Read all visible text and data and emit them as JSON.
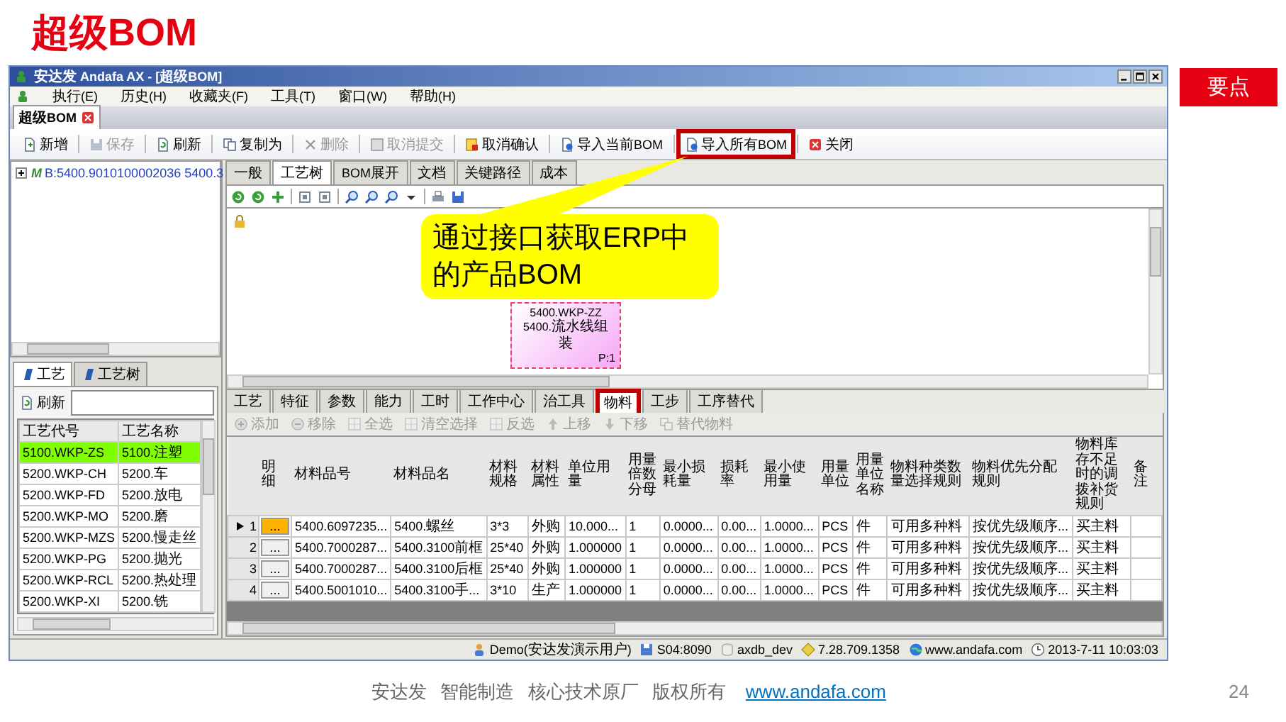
{
  "slide": {
    "title": "超级BOM",
    "aside_heading": "要点",
    "footer_text": "安达发 智能制造 核心技术原厂 版权所有",
    "footer_link": "www.andafa.com",
    "page_number": "24"
  },
  "window": {
    "title": "安达发 Andafa AX - [超级BOM]"
  },
  "menu": [
    "执行(E)",
    "历史(H)",
    "收藏夹(F)",
    "工具(T)",
    "窗口(W)",
    "帮助(H)"
  ],
  "document_tabs": [
    {
      "label": "超级BOM",
      "selected": true
    }
  ],
  "toolbar": [
    {
      "kind": "new",
      "label": "新增",
      "disabled": false,
      "highlighted": false
    },
    {
      "kind": "save",
      "label": "保存",
      "disabled": true,
      "highlighted": false
    },
    {
      "kind": "refresh",
      "label": "刷新",
      "disabled": false,
      "highlighted": false
    },
    {
      "kind": "copy",
      "label": "复制为",
      "disabled": false,
      "highlighted": false
    },
    {
      "kind": "delete",
      "label": "删除",
      "disabled": true,
      "highlighted": false
    },
    {
      "kind": "submit",
      "label": "取消提交",
      "disabled": true,
      "highlighted": false
    },
    {
      "kind": "confirm",
      "label": "取消确认",
      "disabled": false,
      "highlighted": false
    },
    {
      "kind": "import",
      "label": "导入当前BOM",
      "disabled": false,
      "highlighted": false
    },
    {
      "kind": "import",
      "label": "导入所有BOM",
      "disabled": false,
      "highlighted": true
    },
    {
      "kind": "close",
      "label": "关闭",
      "disabled": false,
      "highlighted": false
    }
  ],
  "tree": [
    {
      "badge": "M",
      "label": "B:5400.9010100002036 5400.3",
      "expanded": false
    }
  ],
  "view_tabs": [
    {
      "label": "一般",
      "selected": false
    },
    {
      "label": "工艺树",
      "selected": true
    },
    {
      "label": "BOM展开",
      "selected": false
    },
    {
      "label": "文档",
      "selected": false
    },
    {
      "label": "关键路径",
      "selected": false
    },
    {
      "label": "成本",
      "selected": false
    }
  ],
  "diagram": {
    "nodes": [
      {
        "code": "5400.WKP-ZZ",
        "name": "5400.流水线组装",
        "page": "P:1"
      }
    ]
  },
  "callout": "通过接口获取ERP中的产品BOM",
  "process_panel": {
    "tabs": [
      {
        "label": "工艺",
        "selected": true
      },
      {
        "label": "工艺树",
        "selected": false
      }
    ],
    "refresh_button": "刷新",
    "columns": [
      "工艺代号",
      "工艺名称"
    ],
    "rows": [
      {
        "cells": [
          "5100.WKP-ZS",
          "5100.注塑"
        ],
        "selected": true
      },
      {
        "cells": [
          "5200.WKP-CH",
          "5200.车"
        ],
        "selected": false
      },
      {
        "cells": [
          "5200.WKP-FD",
          "5200.放电"
        ],
        "selected": false
      },
      {
        "cells": [
          "5200.WKP-MO",
          "5200.磨"
        ],
        "selected": false
      },
      {
        "cells": [
          "5200.WKP-MZS",
          "5200.慢走丝"
        ],
        "selected": false
      },
      {
        "cells": [
          "5200.WKP-PG",
          "5200.抛光"
        ],
        "selected": false
      },
      {
        "cells": [
          "5200.WKP-RCL",
          "5200.热处理"
        ],
        "selected": false
      },
      {
        "cells": [
          "5200.WKP-XI",
          "5200.铣"
        ],
        "selected": false
      }
    ]
  },
  "detail_tabs": [
    {
      "label": "工艺",
      "selected": false,
      "highlighted": false
    },
    {
      "label": "特征",
      "selected": false,
      "highlighted": false
    },
    {
      "label": "参数",
      "selected": false,
      "highlighted": false
    },
    {
      "label": "能力",
      "selected": false,
      "highlighted": false
    },
    {
      "label": "工时",
      "selected": false,
      "highlighted": false
    },
    {
      "label": "工作中心",
      "selected": false,
      "highlighted": false
    },
    {
      "label": "治工具",
      "selected": false,
      "highlighted": false
    },
    {
      "label": "物料",
      "selected": true,
      "highlighted": true
    },
    {
      "label": "工步",
      "selected": false,
      "highlighted": false
    },
    {
      "label": "工序替代",
      "selected": false,
      "highlighted": false
    }
  ],
  "detail_toolbar": [
    {
      "kind": "add",
      "label": "添加",
      "disabled": true
    },
    {
      "kind": "remove",
      "label": "移除",
      "disabled": true
    },
    {
      "kind": "select",
      "label": "全选",
      "disabled": true
    },
    {
      "kind": "select",
      "label": "清空选择",
      "disabled": true
    },
    {
      "kind": "select",
      "label": "反选",
      "disabled": true
    },
    {
      "kind": "up",
      "label": "上移",
      "disabled": true
    },
    {
      "kind": "down",
      "label": "下移",
      "disabled": true
    },
    {
      "kind": "replace",
      "label": "替代物料",
      "disabled": true
    }
  ],
  "materials": {
    "detail_column": "明细",
    "columns": [
      "材料品号",
      "材料品名",
      "材料规格",
      "材料属性",
      "单位用量",
      "用量倍数分母",
      "最小损耗量",
      "损耗率",
      "最小使用量",
      "用量单位",
      "用量单位名称",
      "物料种类数量选择规则",
      "物料优先分配规则",
      "物料库存不足时的调拨补货规则",
      "备注"
    ],
    "rows": [
      {
        "number": "1",
        "selected": true,
        "detail": "...",
        "cells": [
          "5400.6097235...",
          "5400.螺丝",
          "3*3",
          "外购",
          "10.000...",
          "1",
          "0.0000...",
          "0.00...",
          "1.0000...",
          "PCS",
          "件",
          "可用多种料",
          "按优先级顺序...",
          "买主料",
          ""
        ]
      },
      {
        "number": "2",
        "selected": false,
        "detail": "...",
        "cells": [
          "5400.7000287...",
          "5400.3100前框",
          "25*40",
          "外购",
          "1.000000",
          "1",
          "0.0000...",
          "0.00...",
          "1.0000...",
          "PCS",
          "件",
          "可用多种料",
          "按优先级顺序...",
          "买主料",
          ""
        ]
      },
      {
        "number": "3",
        "selected": false,
        "detail": "...",
        "cells": [
          "5400.7000287...",
          "5400.3100后框",
          "25*40",
          "外购",
          "1.000000",
          "1",
          "0.0000...",
          "0.00...",
          "1.0000...",
          "PCS",
          "件",
          "可用多种料",
          "按优先级顺序...",
          "买主料",
          ""
        ]
      },
      {
        "number": "4",
        "selected": false,
        "detail": "...",
        "cells": [
          "5400.5001010...",
          "5400.3100手...",
          "3*10",
          "生产",
          "1.000000",
          "1",
          "0.0000...",
          "0.00...",
          "1.0000...",
          "PCS",
          "件",
          "可用多种料",
          "按优先级顺序...",
          "买主料",
          ""
        ]
      }
    ]
  },
  "status_bar": [
    {
      "kind": "user",
      "text": "Demo(安达发演示用户)"
    },
    {
      "kind": "server",
      "text": "S04:8090"
    },
    {
      "kind": "database",
      "text": "axdb_dev"
    },
    {
      "kind": "version",
      "text": "7.28.709.1358"
    },
    {
      "kind": "web",
      "text": "www.andafa.com"
    },
    {
      "kind": "clock",
      "text": "2013-7-11 10:03:03"
    }
  ]
}
